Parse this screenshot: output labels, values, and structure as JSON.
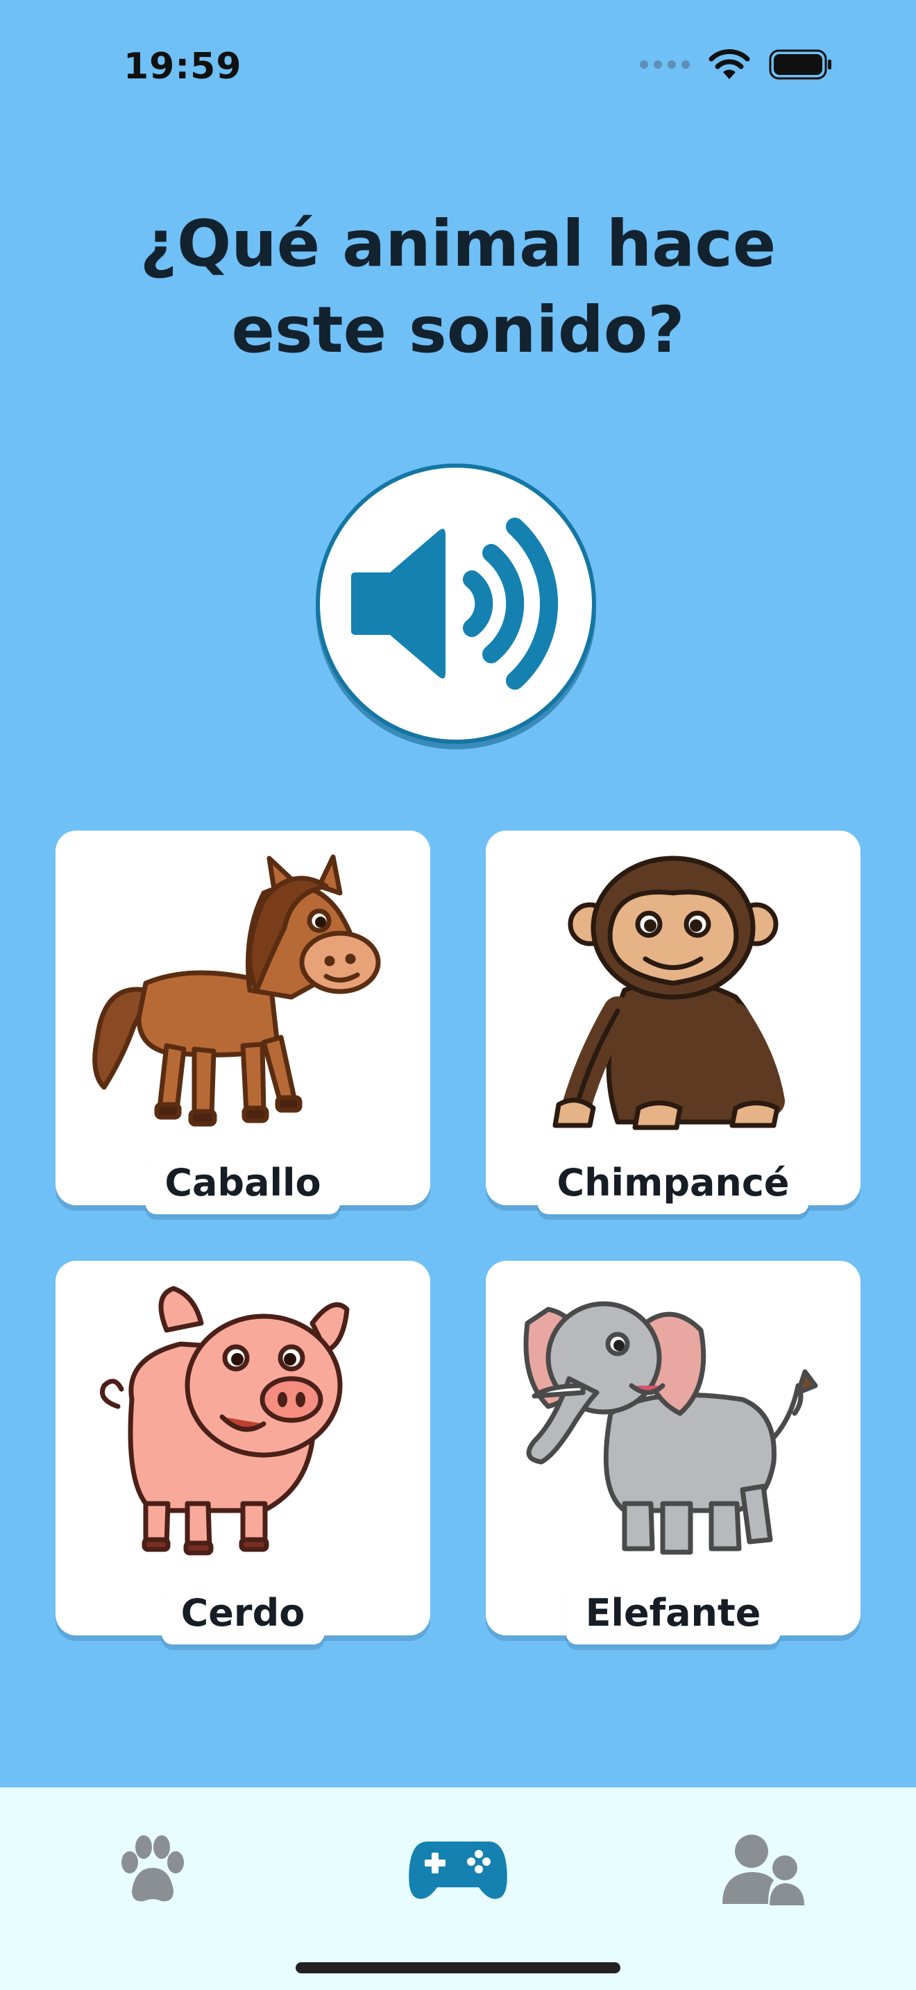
{
  "status": {
    "time": "19:59",
    "icons": [
      "cellular-dots-icon",
      "wifi-icon",
      "battery-icon"
    ]
  },
  "question": "¿Qué animal hace este sonido?",
  "sound_button": {
    "icon": "speaker-icon"
  },
  "options": [
    {
      "label": "Caballo",
      "image": "horse"
    },
    {
      "label": "Chimpancé",
      "image": "chimpanzee"
    },
    {
      "label": "Cerdo",
      "image": "pig"
    },
    {
      "label": "Elefante",
      "image": "elephant"
    }
  ],
  "tabs": [
    {
      "icon": "paw-icon",
      "selected": false
    },
    {
      "icon": "gamepad-icon",
      "selected": true
    },
    {
      "icon": "users-icon",
      "selected": false
    }
  ],
  "colors": {
    "background": "#6fc0f6",
    "accent": "#1476a2",
    "tab_bar": "#e8fdff",
    "tab_inactive": "#8a8f94"
  }
}
